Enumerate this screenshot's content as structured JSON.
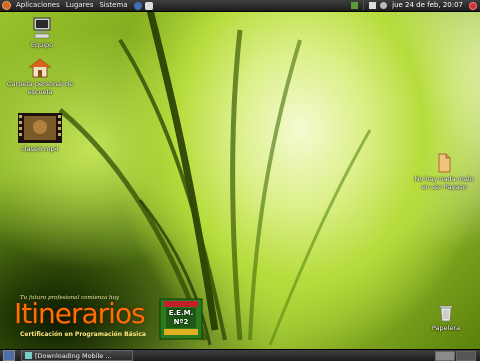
{
  "top_panel": {
    "menus": [
      "Aplicaciones",
      "Lugares",
      "Sistema"
    ],
    "clock": "jue 24 de feb, 20:07"
  },
  "desktop": {
    "icons": [
      {
        "label": "Equipo",
        "icon": "computer-icon"
      },
      {
        "label": "Carpeta personal de escuela",
        "icon": "home-folder-icon"
      },
      {
        "label": "clase8.mp4",
        "icon": "video-file-icon"
      },
      {
        "label": "No hay nada malo en ser Payaso",
        "icon": "file-icon"
      },
      {
        "label": "Papelera",
        "icon": "trash-icon"
      }
    ]
  },
  "logo": {
    "tagline": "Tu futuro profesional comienza hoy",
    "main": "Itinerarios",
    "subtitle": "Certificación en Programación Básica",
    "badge": "E.E.M. Nº2"
  },
  "bottom_panel": {
    "task_label": "[Downloading Mobile ..."
  },
  "colors": {
    "panel": "#262626",
    "logo_orange": "#ff6f00"
  }
}
